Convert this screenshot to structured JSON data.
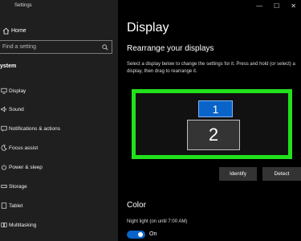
{
  "window": {
    "title": "Settings",
    "controls": [
      "—",
      "☐",
      "✕"
    ]
  },
  "sidebar": {
    "home_label": "Home",
    "search_placeholder": "Find a setting",
    "section_label": "ystem",
    "items": [
      {
        "label": "Display",
        "icon": "monitor-icon"
      },
      {
        "label": "Sound",
        "icon": "speaker-icon"
      },
      {
        "label": "Notifications & actions",
        "icon": "notification-icon"
      },
      {
        "label": "Focus assist",
        "icon": "moon-icon"
      },
      {
        "label": "Power & sleep",
        "icon": "power-icon"
      },
      {
        "label": "Storage",
        "icon": "storage-icon"
      },
      {
        "label": "Tablet",
        "icon": "tablet-icon"
      },
      {
        "label": "Multitasking",
        "icon": "multitasking-icon"
      }
    ]
  },
  "main": {
    "title": "Display",
    "subtitle": "Rearrange your displays",
    "description": "Select a display below to change the settings for it. Press and hold (or select) a display, then drag to rearrange it.",
    "displays": [
      "1",
      "2"
    ],
    "identify_label": "Identify",
    "detect_label": "Detect",
    "color_title": "Color",
    "night_light_label": "Night light (on until 7:00 AM)",
    "night_light_state": "On"
  },
  "colors": {
    "accent": "#0a63c9",
    "highlight": "#22e11c"
  }
}
